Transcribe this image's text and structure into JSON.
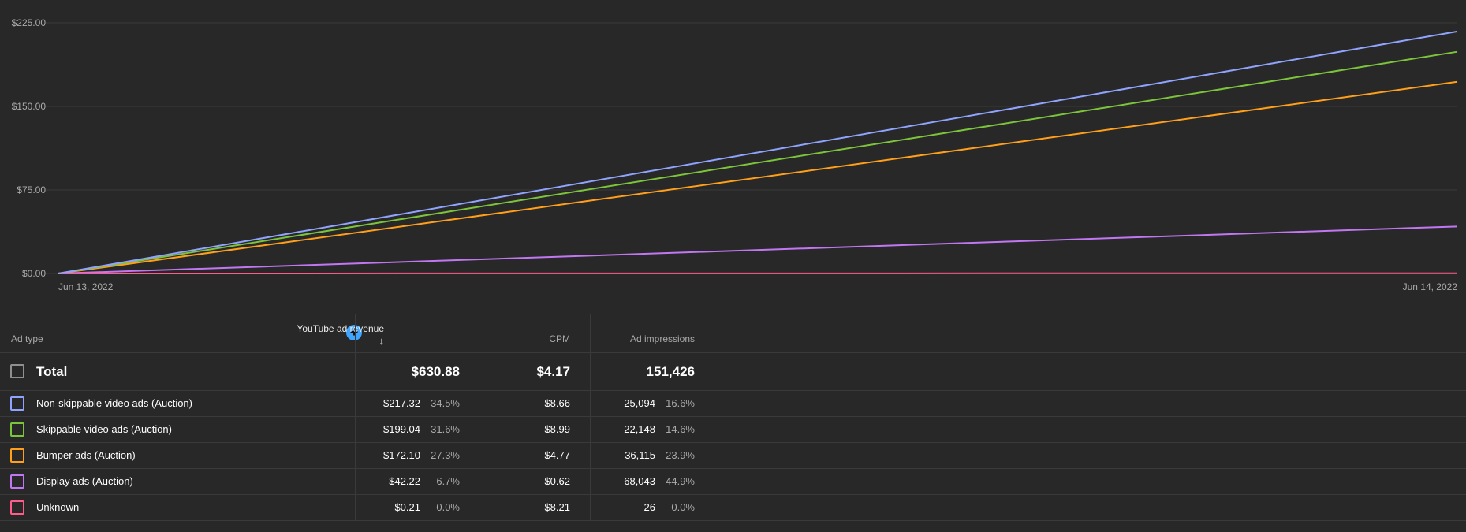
{
  "chart_data": {
    "type": "line",
    "x": [
      "Jun 13, 2022",
      "Jun 14, 2022"
    ],
    "y_ticks": [
      "$0.00",
      "$75.00",
      "$150.00",
      "$225.00"
    ],
    "ylim": [
      0,
      225
    ],
    "grid": true,
    "series": [
      {
        "name": "Non-skippable video ads (Auction)",
        "color": "#8fa3ff",
        "values": [
          0,
          217.32
        ]
      },
      {
        "name": "Skippable video ads (Auction)",
        "color": "#7cc43a",
        "values": [
          0,
          199.04
        ]
      },
      {
        "name": "Bumper ads (Auction)",
        "color": "#ff9f1a",
        "values": [
          0,
          172.1
        ]
      },
      {
        "name": "Display ads (Auction)",
        "color": "#c177f2",
        "values": [
          0,
          42.22
        ]
      },
      {
        "name": "Unknown",
        "color": "#ff5c8a",
        "values": [
          0,
          0.21
        ]
      }
    ]
  },
  "table": {
    "headers": {
      "ad_type": "Ad type",
      "revenue": "YouTube ad revenue",
      "cpm": "CPM",
      "impressions": "Ad impressions",
      "add_icon": "add-metric-icon",
      "sort_icon": "arrow-down-icon"
    },
    "total": {
      "label": "Total",
      "revenue": "$630.88",
      "cpm": "$4.17",
      "impressions": "151,426"
    },
    "rows": [
      {
        "label": "Non-skippable video ads (Auction)",
        "revenue": "$217.32",
        "revenue_pct": "34.5%",
        "cpm": "$8.66",
        "impressions": "25,094",
        "impressions_pct": "16.6%",
        "color": "#8fa3ff"
      },
      {
        "label": "Skippable video ads (Auction)",
        "revenue": "$199.04",
        "revenue_pct": "31.6%",
        "cpm": "$8.99",
        "impressions": "22,148",
        "impressions_pct": "14.6%",
        "color": "#7cc43a"
      },
      {
        "label": "Bumper ads (Auction)",
        "revenue": "$172.10",
        "revenue_pct": "27.3%",
        "cpm": "$4.77",
        "impressions": "36,115",
        "impressions_pct": "23.9%",
        "color": "#ff9f1a"
      },
      {
        "label": "Display ads (Auction)",
        "revenue": "$42.22",
        "revenue_pct": "6.7%",
        "cpm": "$0.62",
        "impressions": "68,043",
        "impressions_pct": "44.9%",
        "color": "#c177f2"
      },
      {
        "label": "Unknown",
        "revenue": "$0.21",
        "revenue_pct": "0.0%",
        "cpm": "$8.21",
        "impressions": "26",
        "impressions_pct": "0.0%",
        "color": "#ff5c8a"
      }
    ]
  }
}
